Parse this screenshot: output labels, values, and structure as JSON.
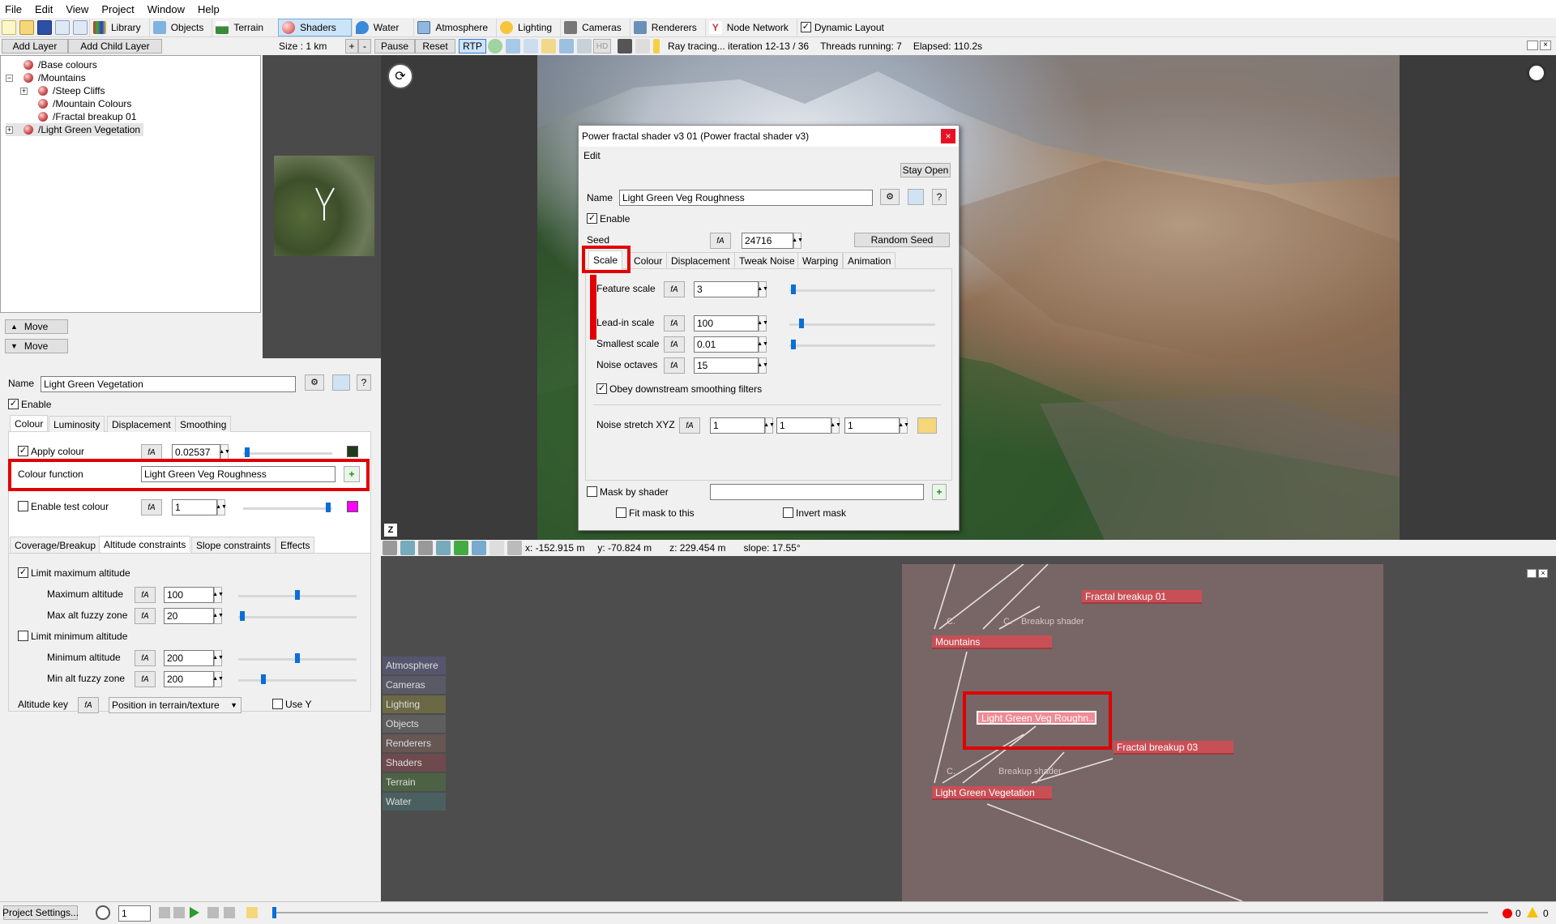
{
  "menu": [
    "File",
    "Edit",
    "View",
    "Project",
    "Window",
    "Help"
  ],
  "toolbar": {
    "buttons": [
      "Library",
      "Objects",
      "Terrain",
      "Shaders",
      "Water",
      "Atmosphere",
      "Lighting",
      "Cameras",
      "Renderers",
      "Node Network"
    ],
    "active": "Shaders",
    "dynamic_layout": "Dynamic Layout"
  },
  "toolbar2": {
    "add_layer": "Add Layer",
    "add_child_layer": "Add Child Layer",
    "size": "Size : 1 km",
    "plus": "+",
    "minus": "-",
    "pause": "Pause",
    "reset": "Reset",
    "rtp": "RTP",
    "hd": "HD",
    "status": "Ray tracing... iteration 12-13 / 36",
    "threads": "Threads running: 7",
    "elapsed": "Elapsed: 110.2s"
  },
  "tree": {
    "items": [
      "/Base colours",
      "/Mountains",
      "/Steep Cliffs",
      "/Mountain Colours",
      "/Fractal breakup 01",
      "/Light Green Vegetation"
    ]
  },
  "move_buttons": [
    "Move",
    "Move"
  ],
  "shader_panel": {
    "name_label": "Name",
    "name_value": "Light Green Vegetation",
    "enable": "Enable",
    "tabs": [
      "Colour",
      "Luminosity",
      "Displacement",
      "Smoothing"
    ],
    "apply_colour": "Apply colour",
    "apply_colour_value": "0.02537",
    "colour_function_label": "Colour function",
    "colour_function_value": "Light Green Veg Roughness",
    "enable_test_colour": "Enable test colour",
    "test_colour_value": "1",
    "tabs2": [
      "Coverage/Breakup",
      "Altitude constraints",
      "Slope constraints",
      "Effects"
    ],
    "limit_max": "Limit maximum altitude",
    "max_alt_label": "Maximum altitude",
    "max_alt": "100",
    "max_fuzzy_label": "Max alt fuzzy zone",
    "max_fuzzy": "20",
    "limit_min": "Limit minimum altitude",
    "min_alt_label": "Minimum altitude",
    "min_alt": "200",
    "min_fuzzy_label": "Min alt fuzzy zone",
    "min_fuzzy": "200",
    "alt_key_label": "Altitude key",
    "alt_key_value": "Position in terrain/texture",
    "use_y": "Use Y",
    "colors": {
      "apply_swatch": "#1f3a1c",
      "test_swatch": "#ff00ff"
    }
  },
  "dialog": {
    "title": "Power fractal shader v3 01    (Power fractal shader v3)",
    "menu": "Edit",
    "stay_open": "Stay Open",
    "name_label": "Name",
    "name_value": "Light Green Veg Roughness",
    "enable": "Enable",
    "seed_label": "Seed",
    "seed_value": "24716",
    "random_seed": "Random Seed",
    "tabs": [
      "Scale",
      "Colour",
      "Displacement",
      "Tweak Noise",
      "Warping",
      "Animation"
    ],
    "feature_scale_label": "Feature scale",
    "feature_scale": "3",
    "leadin_scale_label": "Lead-in scale",
    "leadin_scale": "100",
    "smallest_scale_label": "Smallest scale",
    "smallest_scale": "0.01",
    "noise_octaves_label": "Noise octaves",
    "noise_octaves": "15",
    "obey_smoothing": "Obey downstream smoothing filters",
    "noise_stretch_label": "Noise stretch XYZ",
    "stretch_x": "1",
    "stretch_y": "1",
    "stretch_z": "1",
    "mask_by_shader": "Mask by shader",
    "fit_mask": "Fit mask to this",
    "invert_mask": "Invert mask"
  },
  "viewport_status": {
    "x": "x: -152.915 m",
    "y": "y: -70.824 m",
    "z": "z: 229.454 m",
    "slope": "slope: 17.55°"
  },
  "node_network": {
    "categories": [
      {
        "label": "Atmosphere",
        "color": "#55566e"
      },
      {
        "label": "Cameras",
        "color": "#5a5a66"
      },
      {
        "label": "Lighting",
        "color": "#6b6845"
      },
      {
        "label": "Objects",
        "color": "#5e5e5e"
      },
      {
        "label": "Renderers",
        "color": "#665654"
      },
      {
        "label": "Shaders",
        "color": "#6e4a4e"
      },
      {
        "label": "Terrain",
        "color": "#4d6244"
      },
      {
        "label": "Water",
        "color": "#4a6060"
      }
    ],
    "nodes": [
      "Fractal breakup 01",
      "Mountains",
      "Light Green Veg Roughn...",
      "Fractal breakup 03",
      "Light Green Vegetation"
    ],
    "faint_labels": [
      "C.",
      "C.",
      "Breakup shader",
      "C.",
      "Breakup shader"
    ]
  },
  "bottombar": {
    "project_settings": "Project Settings...",
    "frame": "1",
    "errors": "0",
    "warnings": "0"
  }
}
